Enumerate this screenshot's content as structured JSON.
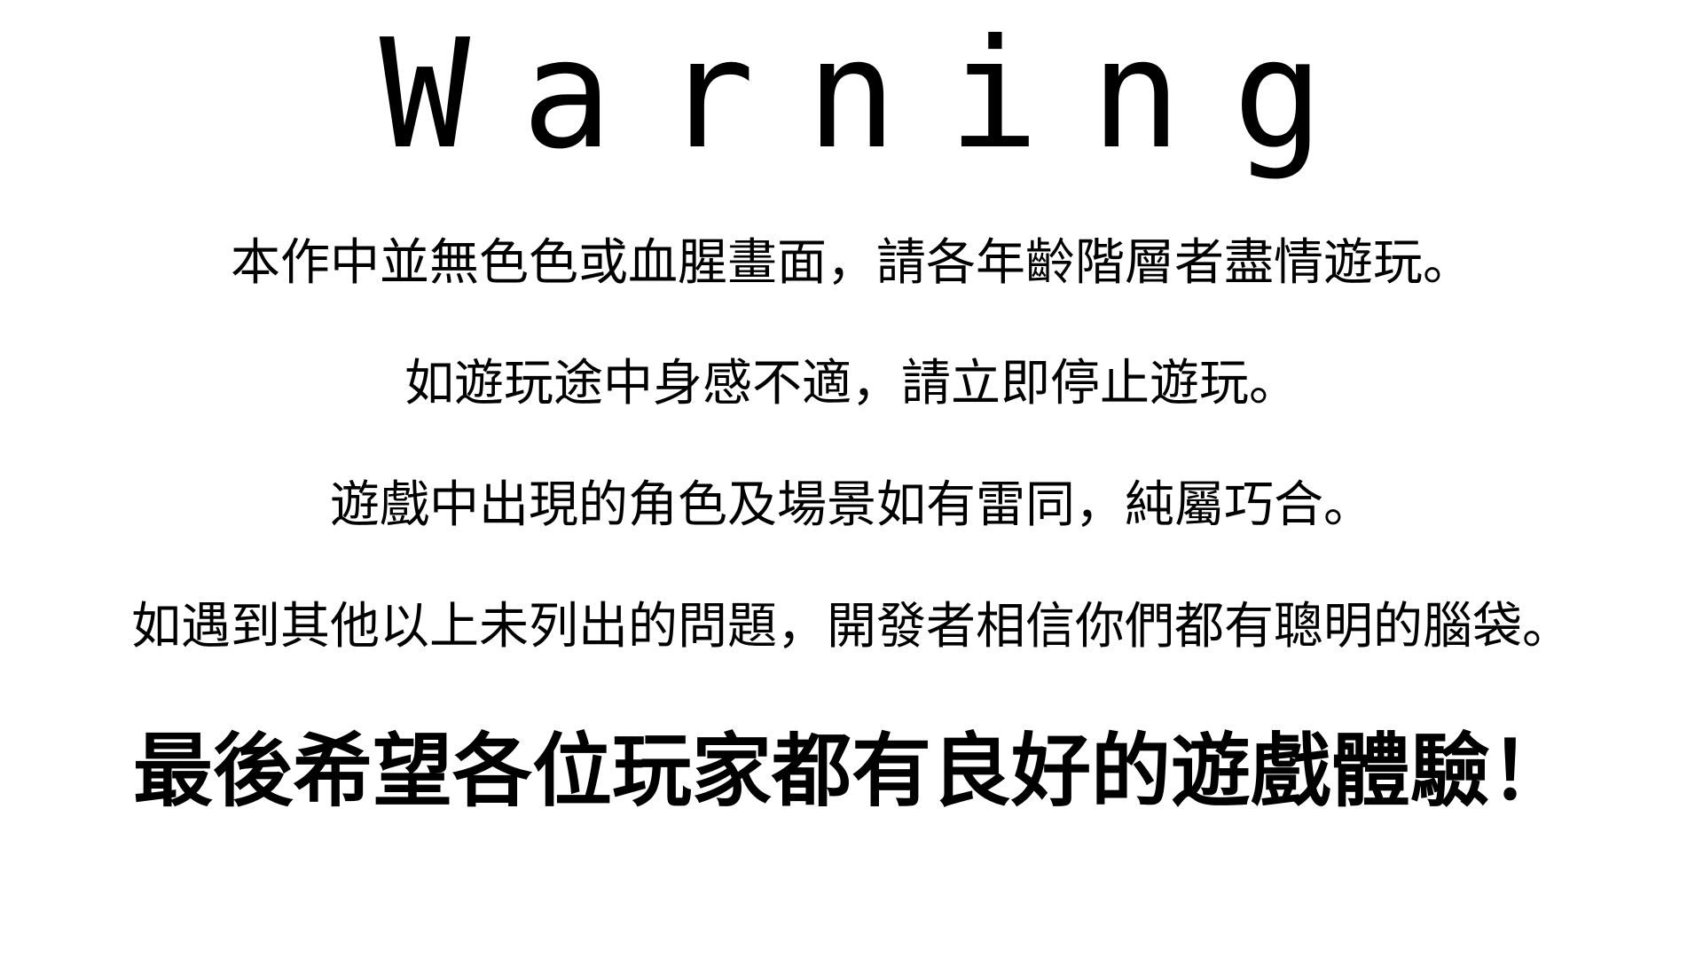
{
  "warning_screen": {
    "title": "Warning",
    "lines": [
      "本作中並無色色或血腥畫面，請各年齡階層者盡情遊玩。",
      "如遊玩途中身感不適，請立即停止遊玩。",
      "遊戲中出現的角色及場景如有雷同，純屬巧合。",
      "如遇到其他以上未列出的問題，開發者相信你們都有聰明的腦袋。"
    ],
    "closing": "最後希望各位玩家都有良好的遊戲體驗！"
  },
  "colors": {
    "background": "#ffffff",
    "text": "#000000"
  }
}
